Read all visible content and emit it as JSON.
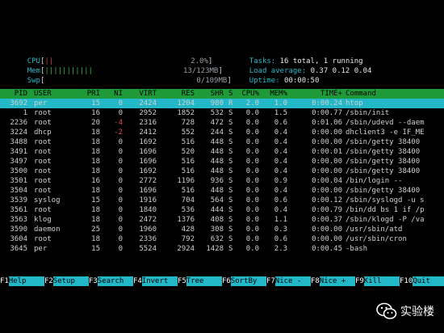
{
  "meters": {
    "cpu": {
      "label": "CPU",
      "bar": "||",
      "value": "2.0%"
    },
    "mem": {
      "label": "Mem",
      "bar": "|||||||||||",
      "value": "13/123MB"
    },
    "swp": {
      "label": "Swp",
      "bar": "",
      "value": "0/109MB"
    }
  },
  "info": {
    "tasks_label": "Tasks:",
    "tasks_value": "16 total, 1 running",
    "load_label": "Load average:",
    "load_value": "0.37 0.12 0.04",
    "uptime_label": "Uptime:",
    "uptime_value": "00:00:50"
  },
  "columns": [
    "PID",
    "USER",
    "PRI",
    "NI",
    "VIRT",
    "RES",
    "SHR",
    "S",
    "CPU%",
    "MEM%",
    "TIME+",
    "Command"
  ],
  "processes": [
    {
      "pid": "3692",
      "user": "per",
      "pri": "15",
      "ni": "0",
      "virt": "2424",
      "res": "1204",
      "shr": "980",
      "s": "R",
      "cpu": "2.0",
      "mem": "1.0",
      "time": "0:00.24",
      "cmd": "htop"
    },
    {
      "pid": "1",
      "user": "root",
      "pri": "16",
      "ni": "0",
      "virt": "2952",
      "res": "1852",
      "shr": "532",
      "s": "S",
      "cpu": "0.0",
      "mem": "1.5",
      "time": "0:00.77",
      "cmd": "/sbin/init"
    },
    {
      "pid": "2236",
      "user": "root",
      "pri": "20",
      "ni": "-4",
      "virt": "2316",
      "res": "728",
      "shr": "472",
      "s": "S",
      "cpu": "0.0",
      "mem": "0.6",
      "time": "0:01.06",
      "cmd": "/sbin/udevd --daem"
    },
    {
      "pid": "3224",
      "user": "dhcp",
      "pri": "18",
      "ni": "-2",
      "virt": "2412",
      "res": "552",
      "shr": "244",
      "s": "S",
      "cpu": "0.0",
      "mem": "0.4",
      "time": "0:00.00",
      "cmd": "dhclient3 -e IF_ME"
    },
    {
      "pid": "3488",
      "user": "root",
      "pri": "18",
      "ni": "0",
      "virt": "1692",
      "res": "516",
      "shr": "448",
      "s": "S",
      "cpu": "0.0",
      "mem": "0.4",
      "time": "0:00.00",
      "cmd": "/sbin/getty 38400"
    },
    {
      "pid": "3491",
      "user": "root",
      "pri": "18",
      "ni": "0",
      "virt": "1696",
      "res": "520",
      "shr": "448",
      "s": "S",
      "cpu": "0.0",
      "mem": "0.4",
      "time": "0:00.01",
      "cmd": "/sbin/getty 38400"
    },
    {
      "pid": "3497",
      "user": "root",
      "pri": "18",
      "ni": "0",
      "virt": "1696",
      "res": "516",
      "shr": "448",
      "s": "S",
      "cpu": "0.0",
      "mem": "0.4",
      "time": "0:00.00",
      "cmd": "/sbin/getty 38400"
    },
    {
      "pid": "3500",
      "user": "root",
      "pri": "18",
      "ni": "0",
      "virt": "1692",
      "res": "516",
      "shr": "448",
      "s": "S",
      "cpu": "0.0",
      "mem": "0.4",
      "time": "0:00.00",
      "cmd": "/sbin/getty 38400"
    },
    {
      "pid": "3501",
      "user": "root",
      "pri": "16",
      "ni": "0",
      "virt": "2772",
      "res": "1196",
      "shr": "936",
      "s": "S",
      "cpu": "0.0",
      "mem": "0.9",
      "time": "0:00.04",
      "cmd": "/bin/login --"
    },
    {
      "pid": "3504",
      "user": "root",
      "pri": "18",
      "ni": "0",
      "virt": "1696",
      "res": "516",
      "shr": "448",
      "s": "S",
      "cpu": "0.0",
      "mem": "0.4",
      "time": "0:00.00",
      "cmd": "/sbin/getty 38400"
    },
    {
      "pid": "3539",
      "user": "syslog",
      "pri": "15",
      "ni": "0",
      "virt": "1916",
      "res": "704",
      "shr": "564",
      "s": "S",
      "cpu": "0.0",
      "mem": "0.6",
      "time": "0:00.12",
      "cmd": "/sbin/syslogd -u s"
    },
    {
      "pid": "3561",
      "user": "root",
      "pri": "18",
      "ni": "0",
      "virt": "1840",
      "res": "536",
      "shr": "444",
      "s": "S",
      "cpu": "0.0",
      "mem": "0.4",
      "time": "0:00.79",
      "cmd": "/bin/dd bs 1 if /p"
    },
    {
      "pid": "3563",
      "user": "klog",
      "pri": "18",
      "ni": "0",
      "virt": "2472",
      "res": "1376",
      "shr": "408",
      "s": "S",
      "cpu": "0.0",
      "mem": "1.1",
      "time": "0:00.37",
      "cmd": "/sbin/klogd -P /va"
    },
    {
      "pid": "3590",
      "user": "daemon",
      "pri": "25",
      "ni": "0",
      "virt": "1960",
      "res": "428",
      "shr": "308",
      "s": "S",
      "cpu": "0.0",
      "mem": "0.3",
      "time": "0:00.00",
      "cmd": "/usr/sbin/atd"
    },
    {
      "pid": "3604",
      "user": "root",
      "pri": "18",
      "ni": "0",
      "virt": "2336",
      "res": "792",
      "shr": "632",
      "s": "S",
      "cpu": "0.0",
      "mem": "0.6",
      "time": "0:00.00",
      "cmd": "/usr/sbin/cron"
    },
    {
      "pid": "3645",
      "user": "per",
      "pri": "15",
      "ni": "0",
      "virt": "5524",
      "res": "2924",
      "shr": "1428",
      "s": "S",
      "cpu": "0.0",
      "mem": "2.3",
      "time": "0:00.45",
      "cmd": "-bash"
    }
  ],
  "footer": [
    {
      "key": "F1",
      "label": "Help"
    },
    {
      "key": "F2",
      "label": "Setup"
    },
    {
      "key": "F3",
      "label": "Search"
    },
    {
      "key": "F4",
      "label": "Invert"
    },
    {
      "key": "F5",
      "label": "Tree"
    },
    {
      "key": "F6",
      "label": "SortBy"
    },
    {
      "key": "F7",
      "label": "Nice -"
    },
    {
      "key": "F8",
      "label": "Nice +"
    },
    {
      "key": "F9",
      "label": "Kill"
    },
    {
      "key": "F10",
      "label": "Quit"
    }
  ],
  "watermark": {
    "text": "实验楼",
    "icon": "wechat-icon"
  },
  "colors": {
    "cyan": "#22b8c8",
    "header_green": "#1f9a3a",
    "red": "#c83a3a"
  }
}
